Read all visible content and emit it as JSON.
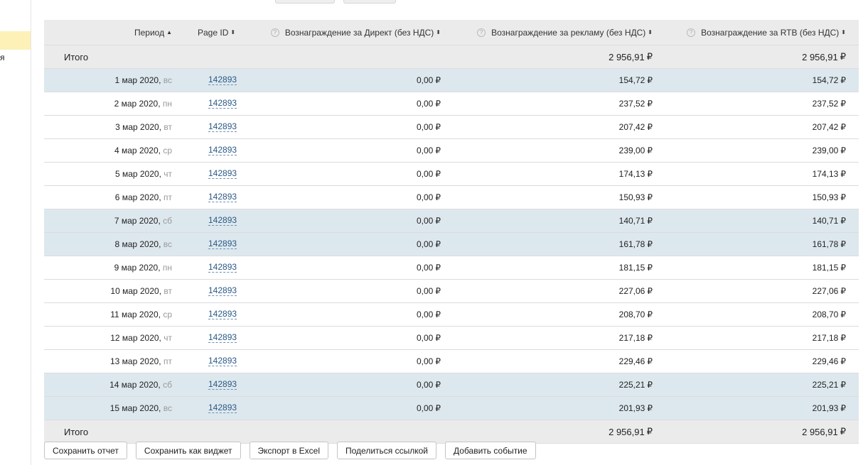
{
  "sidebar": {
    "truncated_text": "я"
  },
  "table": {
    "columns": {
      "period": "Период",
      "page_id": "Page ID",
      "direct": "Вознаграждение за Директ (без НДС)",
      "ads": "Вознаграждение за рекламу (без НДС)",
      "rtb": "Вознаграждение за RTB (без НДС)"
    },
    "sort_asc_icon": "▲",
    "sort_both_icon": "⬍",
    "help_icon": "?",
    "currency": "₽",
    "total_top": {
      "label": "Итого",
      "direct": "",
      "ads": "2 956,91",
      "rtb": "2 956,91"
    },
    "rows": [
      {
        "date": "1 мар 2020,",
        "wd": "вс",
        "page": "142893",
        "direct": "0,00",
        "ads": "154,72",
        "rtb": "154,72"
      },
      {
        "date": "2 мар 2020,",
        "wd": "пн",
        "page": "142893",
        "direct": "0,00",
        "ads": "237,52",
        "rtb": "237,52"
      },
      {
        "date": "3 мар 2020,",
        "wd": "вт",
        "page": "142893",
        "direct": "0,00",
        "ads": "207,42",
        "rtb": "207,42"
      },
      {
        "date": "4 мар 2020,",
        "wd": "ср",
        "page": "142893",
        "direct": "0,00",
        "ads": "239,00",
        "rtb": "239,00"
      },
      {
        "date": "5 мар 2020,",
        "wd": "чт",
        "page": "142893",
        "direct": "0,00",
        "ads": "174,13",
        "rtb": "174,13"
      },
      {
        "date": "6 мар 2020,",
        "wd": "пт",
        "page": "142893",
        "direct": "0,00",
        "ads": "150,93",
        "rtb": "150,93"
      },
      {
        "date": "7 мар 2020,",
        "wd": "сб",
        "page": "142893",
        "direct": "0,00",
        "ads": "140,71",
        "rtb": "140,71"
      },
      {
        "date": "8 мар 2020,",
        "wd": "вс",
        "page": "142893",
        "direct": "0,00",
        "ads": "161,78",
        "rtb": "161,78"
      },
      {
        "date": "9 мар 2020,",
        "wd": "пн",
        "page": "142893",
        "direct": "0,00",
        "ads": "181,15",
        "rtb": "181,15"
      },
      {
        "date": "10 мар 2020,",
        "wd": "вт",
        "page": "142893",
        "direct": "0,00",
        "ads": "227,06",
        "rtb": "227,06"
      },
      {
        "date": "11 мар 2020,",
        "wd": "ср",
        "page": "142893",
        "direct": "0,00",
        "ads": "208,70",
        "rtb": "208,70"
      },
      {
        "date": "12 мар 2020,",
        "wd": "чт",
        "page": "142893",
        "direct": "0,00",
        "ads": "217,18",
        "rtb": "217,18"
      },
      {
        "date": "13 мар 2020,",
        "wd": "пт",
        "page": "142893",
        "direct": "0,00",
        "ads": "229,46",
        "rtb": "229,46"
      },
      {
        "date": "14 мар 2020,",
        "wd": "сб",
        "page": "142893",
        "direct": "0,00",
        "ads": "225,21",
        "rtb": "225,21"
      },
      {
        "date": "15 мар 2020,",
        "wd": "вс",
        "page": "142893",
        "direct": "0,00",
        "ads": "201,93",
        "rtb": "201,93"
      }
    ],
    "total_bottom": {
      "label": "Итого",
      "direct": "",
      "ads": "2 956,91",
      "rtb": "2 956,91"
    }
  },
  "toolbar": {
    "save_report": "Сохранить отчет",
    "save_widget": "Сохранить как виджет",
    "export_excel": "Экспорт в Excel",
    "share_link": "Поделиться ссылкой",
    "add_event": "Добавить событие"
  },
  "colors": {
    "weekend_row": "#dde8ee",
    "header_bg": "#ebebeb",
    "link": "#2a5885",
    "highlight": "#fdf1b8"
  }
}
